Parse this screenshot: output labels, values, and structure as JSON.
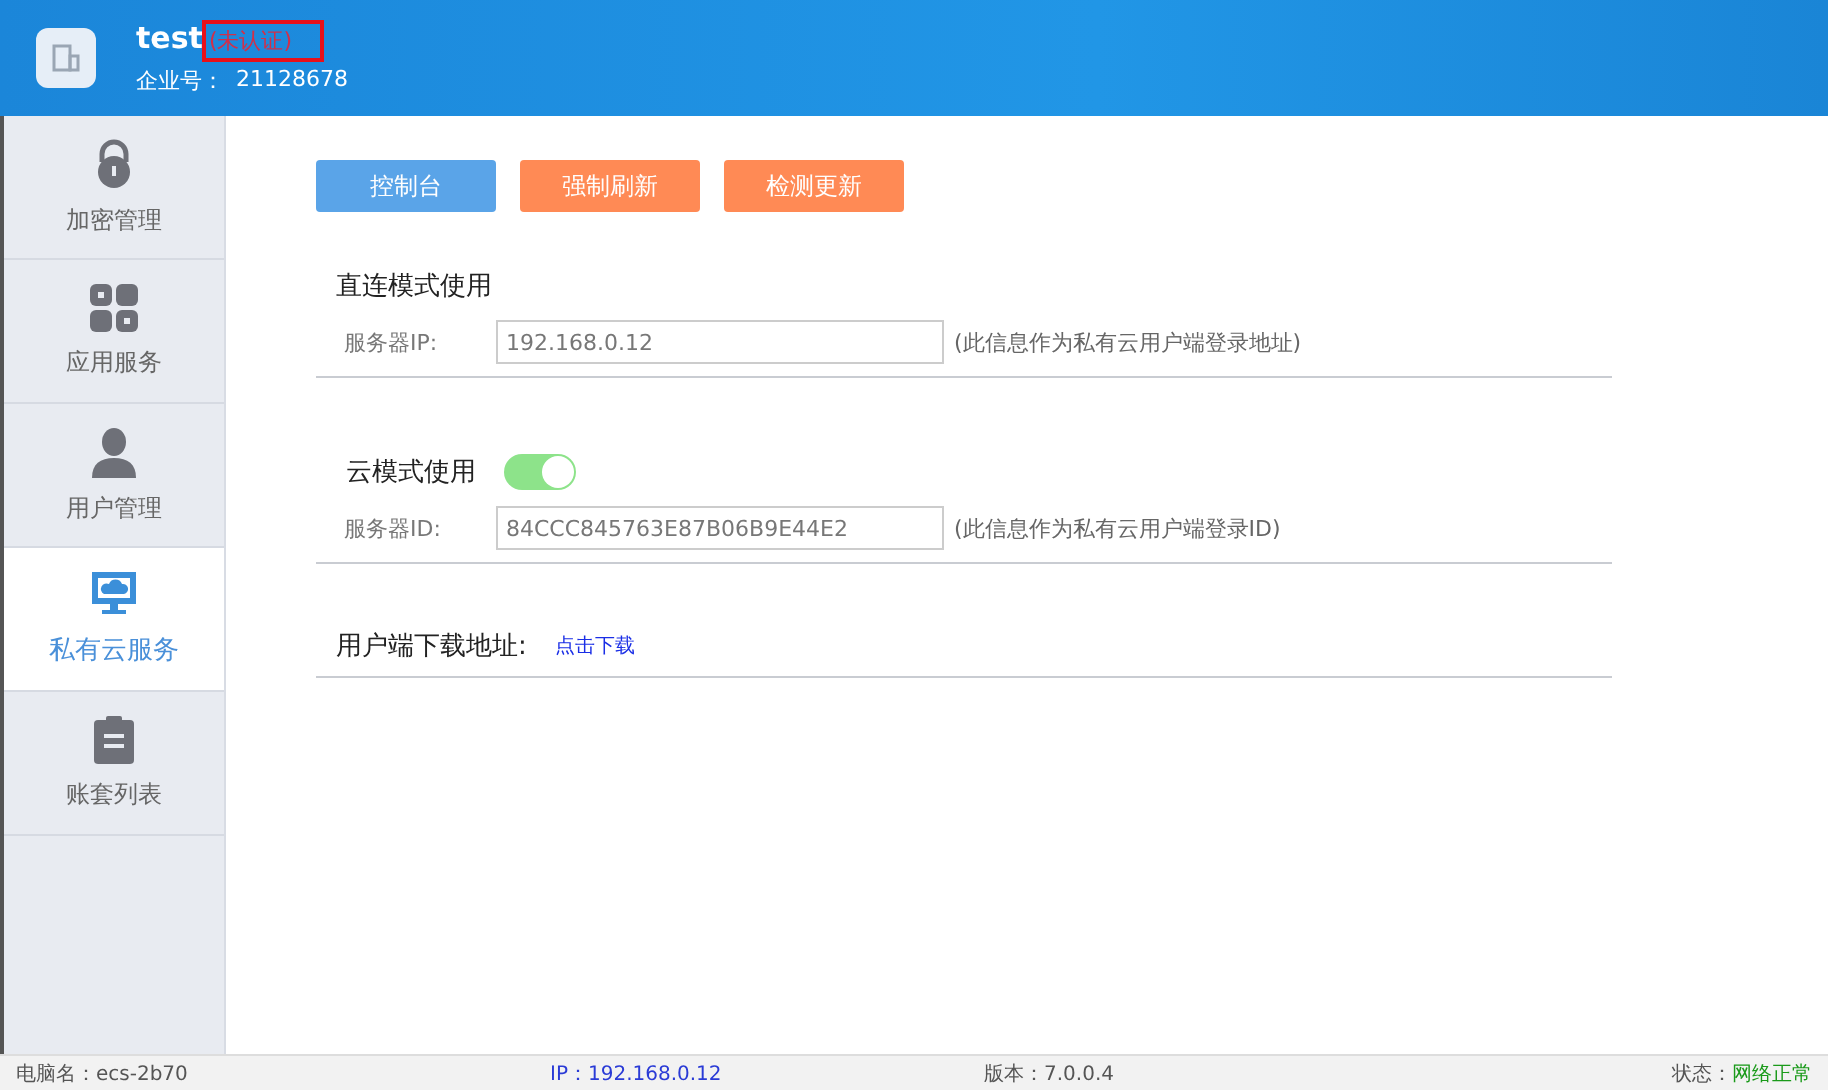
{
  "header": {
    "company_name": "test",
    "status": "(未认证)",
    "status_highlighted": true,
    "id_label": "企业号：",
    "id_value": "21128678"
  },
  "sidebar": {
    "items": [
      {
        "kind": "lock",
        "label": "加密管理",
        "selected": false
      },
      {
        "kind": "apps",
        "label": "应用服务",
        "selected": false
      },
      {
        "kind": "user",
        "label": "用户管理",
        "selected": false
      },
      {
        "kind": "cloud",
        "label": "私有云服务",
        "selected": true
      },
      {
        "kind": "clipboard",
        "label": "账套列表",
        "selected": false
      }
    ]
  },
  "toolbar": {
    "buttons": [
      {
        "label": "控制台",
        "kind": "primary"
      },
      {
        "label": "强制刷新",
        "kind": "warning"
      },
      {
        "label": "检测更新",
        "kind": "warning"
      }
    ]
  },
  "direct_mode": {
    "title": "直连模式使用",
    "field_label": "服务器IP:",
    "value": "192.168.0.12",
    "note": "(此信息作为私有云用户端登录地址)"
  },
  "cloud_mode": {
    "title": "云模式使用",
    "on": true,
    "field_label": "服务器ID:",
    "value": "84CCC845763E87B06B9E44E2",
    "note": "(此信息作为私有云用户端登录ID)"
  },
  "download": {
    "title": "用户端下载地址:",
    "link": "点击下载"
  },
  "status_bar": {
    "computer": "电脑名：ecs-2b70",
    "ip": "IP：192.168.0.12",
    "version": "版本：7.0.0.4",
    "state_label": "状态：",
    "state_value": "网络正常"
  }
}
